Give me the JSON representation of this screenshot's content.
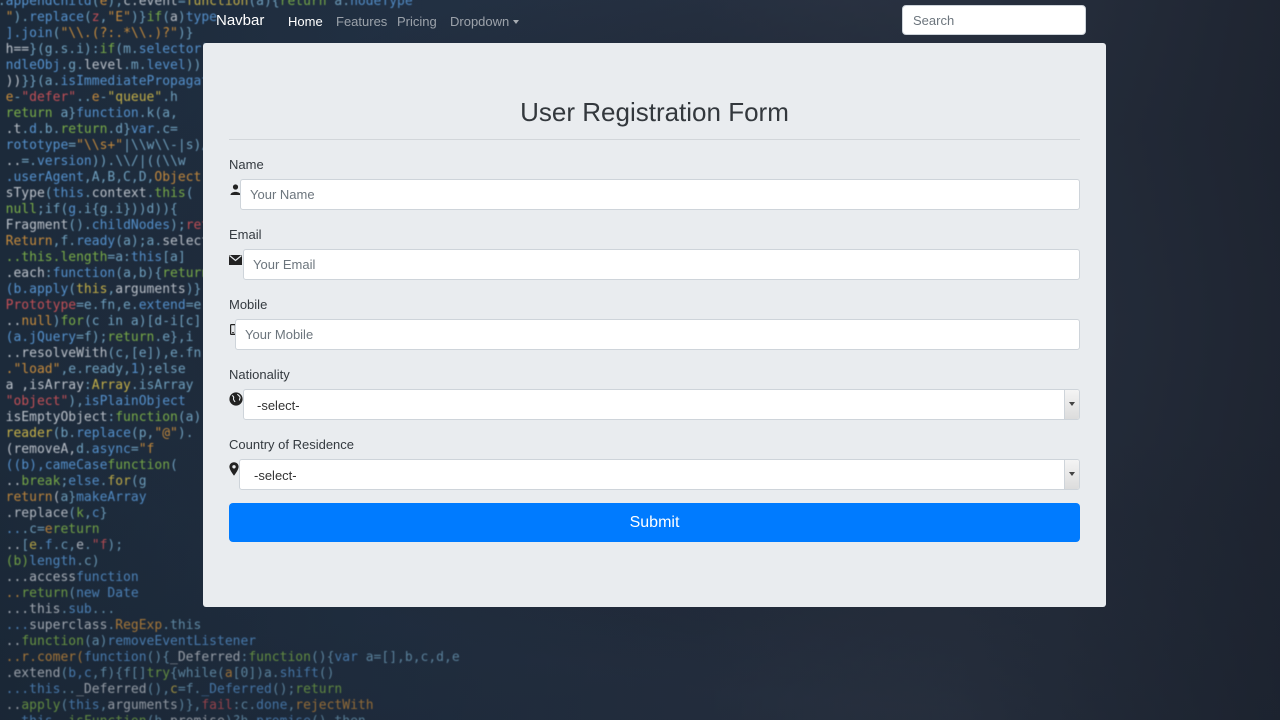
{
  "navbar": {
    "brand": "Navbar",
    "links": [
      "Home",
      "Features",
      "Pricing",
      "Dropdown"
    ],
    "active": "Home",
    "search_placeholder": "Search"
  },
  "form": {
    "title": "User Registration Form",
    "fields": {
      "name": {
        "label": "Name",
        "placeholder": "Your Name",
        "icon": "user-icon"
      },
      "email": {
        "label": "Email",
        "placeholder": "Your Email",
        "icon": "envelope-icon"
      },
      "mobile": {
        "label": "Mobile",
        "placeholder": "Your Mobile",
        "icon": "mobile-icon"
      },
      "nationality": {
        "label": "Nationality",
        "value": "-select-",
        "icon": "globe-icon"
      },
      "residence": {
        "label": "Country of Residence",
        "value": "-select-",
        "icon": "map-marker-icon"
      }
    },
    "submit_label": "Submit"
  },
  "colors": {
    "primary": "#007bff",
    "card_bg": "#e9ecef"
  }
}
